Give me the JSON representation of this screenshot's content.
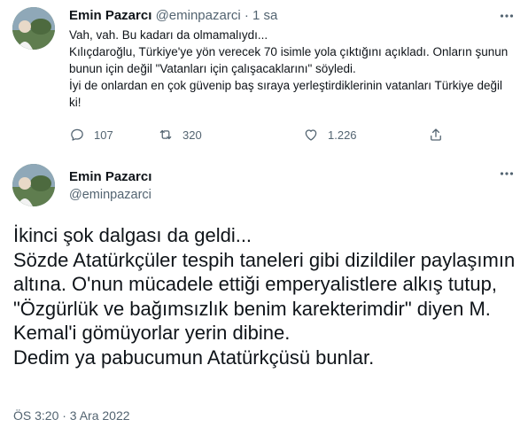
{
  "tweet1": {
    "author_name": "Emin Pazarcı",
    "handle": "@eminpazarci",
    "separator": "·",
    "time": "1 sa",
    "more_icon": "more-horizontal-icon",
    "lines": [
      "Vah, vah. Bu kadarı da olmamalıydı...",
      "Kılıçdaroğlu, Türkiye'ye yön verecek 70 isimle yola çıktığını açıkladı. Onların şunun bunun için değil \"Vatanları için çalışacaklarını\" söyledi.",
      "İyi de onlardan en çok güvenip baş sıraya yerleştirdiklerinin vatanları Türkiye değil ki!"
    ],
    "actions": {
      "reply_count": "107",
      "retweet_count": "320",
      "like_count": "1.226"
    }
  },
  "tweet2": {
    "author_name": "Emin Pazarcı",
    "handle": "@eminpazarci",
    "more_icon": "more-horizontal-icon",
    "lines": [
      "İkinci şok dalgası da geldi...",
      "Sözde Atatürkçüler tespih taneleri gibi dizildiler paylaşımın altına. O'nun mücadele ettiği emperyalistlere alkış tutup, \"Özgürlük ve bağımsızlık benim karekterimdir\" diyen M. Kemal'i gömüyorlar yerin dibine.",
      "Dedim ya pabucumun Atatürkçüsü bunlar."
    ],
    "timestamp": "ÖS 3:20 · 3 Ara 2022"
  },
  "colors": {
    "text": "#0f1419",
    "muted": "#536471"
  }
}
